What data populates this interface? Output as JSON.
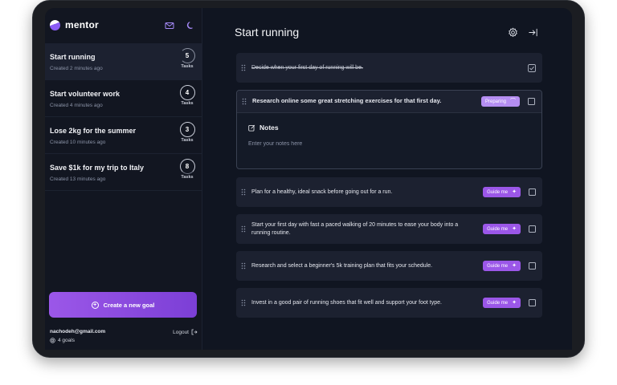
{
  "app": {
    "name": "mentor"
  },
  "sidebar": {
    "goals": [
      {
        "title": "Start running",
        "created": "Created 2 minutes ago",
        "count": "5",
        "count_label": "Tasks",
        "active": true
      },
      {
        "title": "Start volunteer work",
        "created": "Created 4 minutes ago",
        "count": "4",
        "count_label": "Tasks",
        "active": false
      },
      {
        "title": "Lose 2kg for the summer",
        "created": "Created 10 minutes ago",
        "count": "3",
        "count_label": "Tasks",
        "active": false
      },
      {
        "title": "Save $1k for my trip to Italy",
        "created": "Created 13 minutes ago",
        "count": "8",
        "count_label": "Tasks",
        "active": false
      }
    ],
    "create_button": "Create a new goal",
    "user_email": "nachodeh@gmail.com",
    "logout": "Logout",
    "goal_count": "4 goals"
  },
  "main": {
    "title": "Start running",
    "tasks": [
      {
        "text": "Decide when your first day of running will be.",
        "done": true
      },
      {
        "text": "Research online some great stretching exercises for that first day.",
        "chip": "Preparing",
        "expanded": true
      },
      {
        "text": "Plan for a healthy, ideal snack before going out for a run.",
        "chip": "Guide me"
      },
      {
        "text": "Start your first day with fast a paced walking of 20 minutes to ease your body into a running routine.",
        "chip": "Guide me"
      },
      {
        "text": "Research and select a beginner's 5k training plan that fits your schedule.",
        "chip": "Guide me"
      },
      {
        "text": "Invest in a good pair of running shoes that fit well and support your foot type.",
        "chip": "Guide me"
      }
    ],
    "notes": {
      "title": "Notes",
      "placeholder": "Enter your notes here"
    }
  },
  "colors": {
    "accent": "#9b57e8",
    "background": "#101521",
    "card": "#1c2130"
  }
}
